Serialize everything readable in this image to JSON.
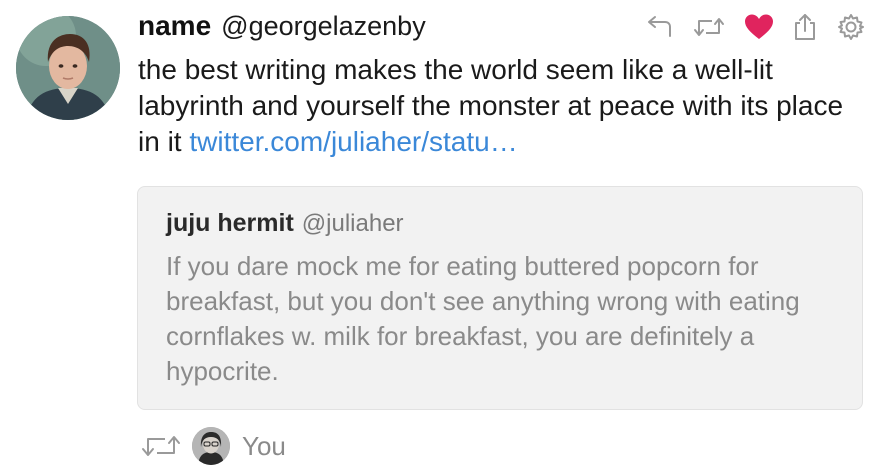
{
  "tweet": {
    "display_name": "name",
    "handle": "@georgelazenby",
    "text": "the best writing makes the world seem like a well-lit labyrinth and yourself the monster at peace with its place in it ",
    "link_text": "twitter.com/juliaher/statu…",
    "avatar_icon": "child-portrait-avatar",
    "actions": [
      {
        "name": "reply",
        "icon": "reply-arrow-icon",
        "color": "#9a9a9a"
      },
      {
        "name": "retweet",
        "icon": "retweet-icon",
        "color": "#9a9a9a"
      },
      {
        "name": "like",
        "icon": "heart-icon",
        "color": "#e0245e",
        "state": "liked"
      },
      {
        "name": "share",
        "icon": "share-icon",
        "color": "#9a9a9a"
      },
      {
        "name": "more",
        "icon": "gear-icon",
        "color": "#9a9a9a"
      }
    ]
  },
  "quoted_tweet": {
    "display_name": "juju hermit",
    "handle": "@juliaher",
    "text": "If you dare mock me for eating buttered popcorn for breakfast, but you don't see anything wrong with eating cornflakes w. milk for breakfast, you are definitely a hypocrite."
  },
  "footer": {
    "retweet_icon": "retweet-icon",
    "avatar_icon": "user-avatar",
    "label": "You"
  },
  "colors": {
    "link": "#3b88d8",
    "like": "#e0245e",
    "muted": "#8a8a8a",
    "quote_bg": "#f2f2f2"
  }
}
